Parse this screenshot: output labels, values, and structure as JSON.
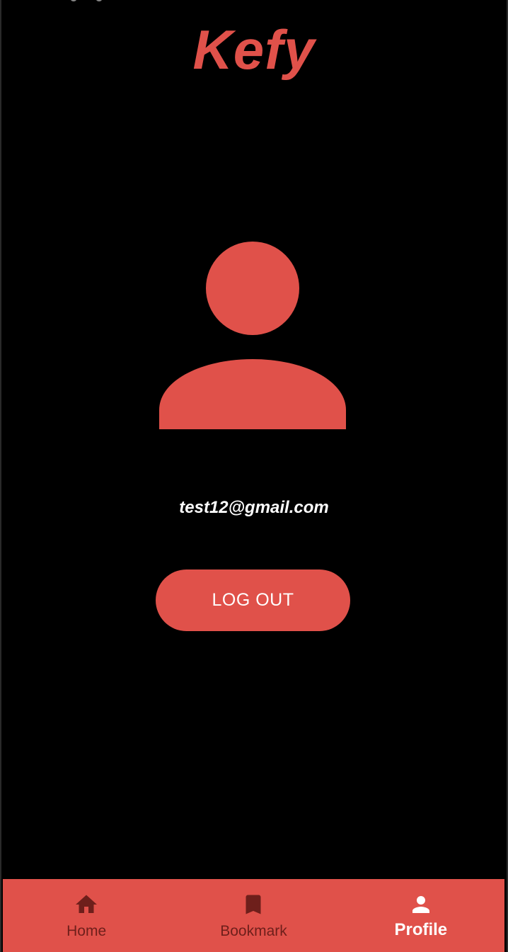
{
  "app": {
    "title": "Kefy"
  },
  "profile": {
    "avatar_icon": "person-icon",
    "email": "test12@gmail.com",
    "logout_label": "LOG OUT"
  },
  "bottom_nav": {
    "items": [
      {
        "label": "Home",
        "icon": "home-icon",
        "active": false
      },
      {
        "label": "Bookmark",
        "icon": "bookmark-icon",
        "active": false
      },
      {
        "label": "Profile",
        "icon": "person-icon",
        "active": true
      }
    ]
  },
  "colors": {
    "background": "#000000",
    "accent": "#e0514a",
    "nav_inactive": "#6e1f1b",
    "nav_active": "#ffffff",
    "text": "#ffffff"
  }
}
